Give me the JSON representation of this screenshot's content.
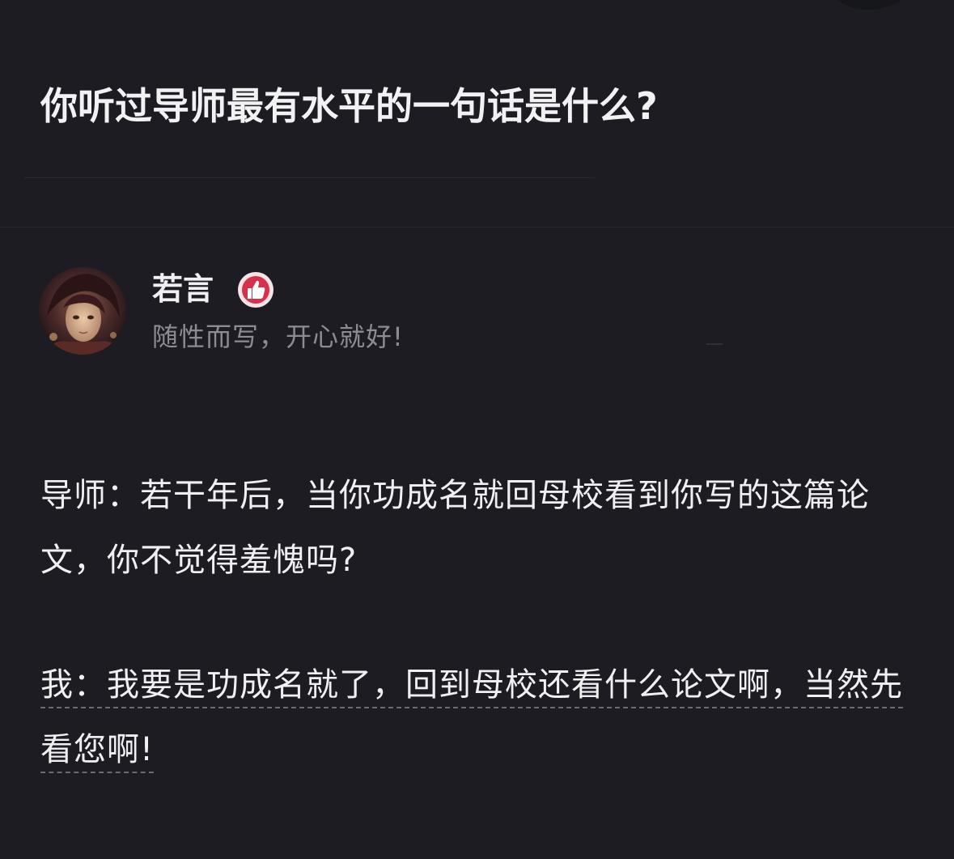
{
  "question": {
    "title": "你听过导师最有水平的一句话是什么?"
  },
  "author": {
    "name": "若言",
    "bio": "随性而写，开心就好!",
    "badge_icon": "thumbs-up-badge-icon",
    "avatar": "avatar"
  },
  "answer": {
    "paragraphs": [
      "导师：若干年后，当你功成名就回母校看到你写的这篇论文，你不觉得羞愧吗?",
      "我：我要是功成名就了，回到母校还看什么论文啊，当然先看您啊!"
    ]
  },
  "colors": {
    "background": "#1c1c22",
    "text_primary": "#f0f0f2",
    "text_secondary": "#8c8c94",
    "badge_red": "#d7304a",
    "divider": "#26272c"
  }
}
